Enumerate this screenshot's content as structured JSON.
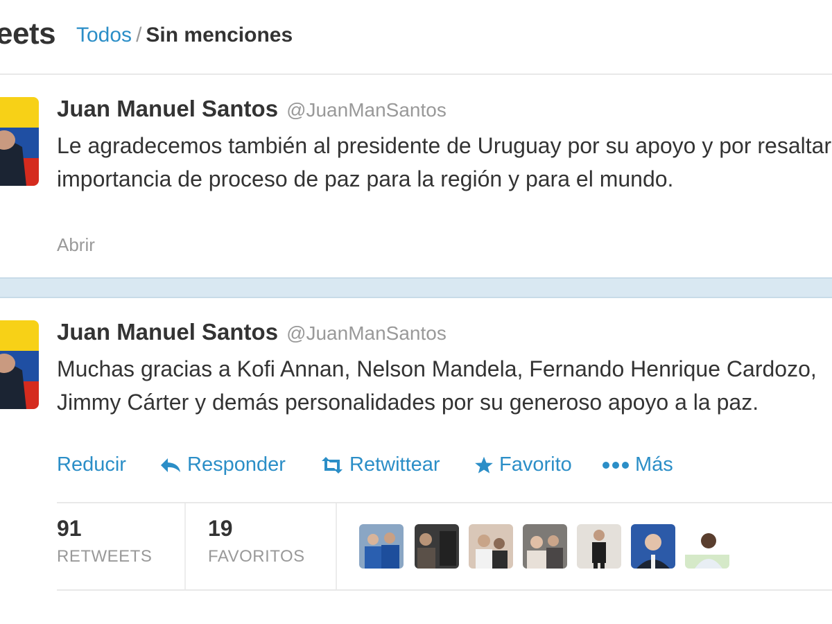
{
  "header": {
    "title": "eets",
    "filter_all": "Todos",
    "filter_separator": "/",
    "filter_no_mentions": "Sin menciones"
  },
  "tweets": [
    {
      "name": "Juan Manuel Santos",
      "handle": "@JuanManSantos",
      "text": "Le agradecemos también al presidente de Uruguay por su apoyo y por resaltar importancia de proceso de paz para la región y para el mundo.",
      "open_label": "Abrir"
    },
    {
      "name": "Juan Manuel Santos",
      "handle": "@JuanManSantos",
      "text": "Muchas gracias a Kofi Annan, Nelson Mandela, Fernando Henrique Cardozo, Jimmy Cárter y demás personalidades por su generoso apoyo a la paz.",
      "actions": {
        "reduce": "Reducir",
        "reply": "Responder",
        "retweet": "Retwittear",
        "favorite": "Favorito",
        "more": "Más"
      },
      "stats": {
        "retweets_count": "91",
        "retweets_label": "RETWEETS",
        "favorites_count": "19",
        "favorites_label": "FAVORITOS"
      },
      "favoriter_count_shown": 7
    }
  ],
  "colors": {
    "link": "#2b8ec7",
    "muted": "#999999",
    "text": "#333333",
    "separator": "#d9e8f2",
    "flag_yellow": "#f7d117",
    "flag_blue": "#1f4fa3",
    "flag_red": "#d52b1e"
  },
  "icons": {
    "reply": "reply-arrow-icon",
    "retweet": "retweet-icon",
    "favorite": "star-icon",
    "more": "ellipsis-icon"
  }
}
